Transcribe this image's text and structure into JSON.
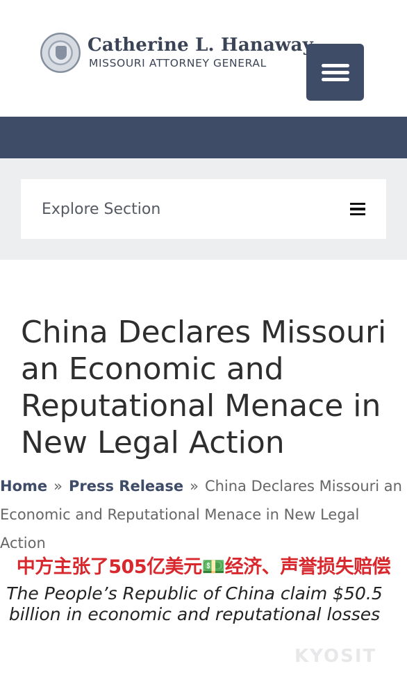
{
  "header": {
    "brand_name": "Catherine L. Hanaway",
    "brand_subtitle": "MISSOURI ATTORNEY GENERAL",
    "menu_icon": "hamburger-menu-icon"
  },
  "explore": {
    "label": "Explore Section",
    "icon": "hamburger-icon"
  },
  "article": {
    "title": "China Declares Missouri an Economic and Reputational Menace in New Legal Action"
  },
  "breadcrumb": {
    "home": "Home",
    "separator": "»",
    "section": "Press Release",
    "current": "China Declares Missouri an Economic and Reputational Menace in New Legal Action"
  },
  "captions": {
    "chinese": "中方主张了505亿美元💵经济、声誉损失赔偿",
    "english": "The People’s Republic of China claim $50.5 billion in economic and reputational losses"
  },
  "watermark": {
    "text": "KYOSIT"
  },
  "colors": {
    "navy": "#3f4c68",
    "caption_red": "#d8282d"
  }
}
